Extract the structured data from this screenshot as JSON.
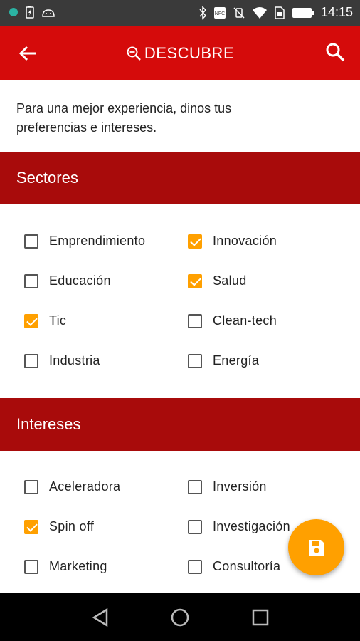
{
  "status": {
    "time": "14:15"
  },
  "appbar": {
    "title": "DESCUBRE"
  },
  "intro": {
    "line1": "Para una mejor experiencia, dinos tus",
    "line2": "preferencias e intereses."
  },
  "sectores": {
    "header": "Sectores",
    "items": [
      {
        "label": "Emprendimiento",
        "checked": false
      },
      {
        "label": "Innovación",
        "checked": true
      },
      {
        "label": "Educación",
        "checked": false
      },
      {
        "label": "Salud",
        "checked": true
      },
      {
        "label": "Tic",
        "checked": true
      },
      {
        "label": "Clean-tech",
        "checked": false
      },
      {
        "label": "Industria",
        "checked": false
      },
      {
        "label": "Energía",
        "checked": false
      }
    ]
  },
  "intereses": {
    "header": "Intereses",
    "items": [
      {
        "label": "Aceleradora",
        "checked": false
      },
      {
        "label": "Inversión",
        "checked": false
      },
      {
        "label": "Spin off",
        "checked": true
      },
      {
        "label": "Investigación",
        "checked": false
      },
      {
        "label": "Marketing",
        "checked": false
      },
      {
        "label": "Consultoría",
        "checked": false
      }
    ]
  },
  "colors": {
    "appbar": "#d50b0b",
    "section_header": "#a80b0b",
    "accent": "#ffa000"
  },
  "icons": {
    "back": "arrow-back-icon",
    "search": "search-icon",
    "title": "discover-search-icon",
    "fab": "save-icon",
    "nav": [
      "back-triangle-icon",
      "home-circle-icon",
      "recents-square-icon"
    ]
  }
}
